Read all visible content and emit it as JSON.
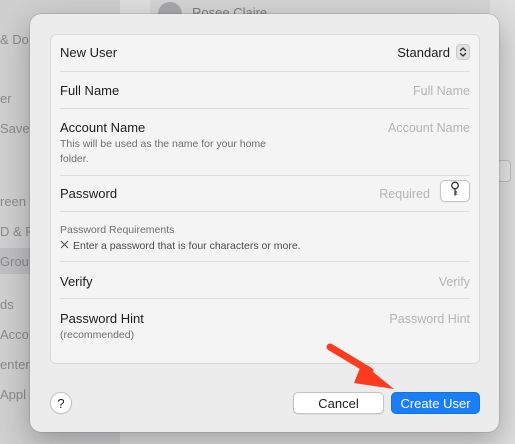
{
  "background": {
    "sidebar_fragments": [
      "& Do",
      "er",
      "Saver",
      "reen",
      "D & Pa",
      "Grou",
      "ds",
      "Acco",
      "enter",
      "Appl"
    ],
    "user_row_name": "Rosee Claire"
  },
  "sheet": {
    "fields": {
      "new_user": {
        "label": "New User",
        "value": "Standard"
      },
      "full_name": {
        "label": "Full Name",
        "placeholder": "Full Name"
      },
      "account_name": {
        "label": "Account Name",
        "sublabel": "This will be used as the name for your home folder.",
        "placeholder": "Account Name"
      },
      "password": {
        "label": "Password",
        "placeholder": "Required"
      },
      "password_requirements": {
        "title": "Password Requirements",
        "item": "Enter a password that is four characters or more."
      },
      "verify": {
        "label": "Verify",
        "placeholder": "Verify"
      },
      "password_hint": {
        "label": "Password Hint",
        "sublabel": "(recommended)",
        "placeholder": "Password Hint"
      }
    },
    "footer": {
      "help_label": "?",
      "cancel_label": "Cancel",
      "create_label": "Create User"
    }
  },
  "icons": {
    "select_stepper": "chevron-up-down-icon",
    "key": "key-icon",
    "requirement_status": "x-mark-icon",
    "annotation": "red-arrow-icon"
  },
  "colors": {
    "accent": "#1a7ef6",
    "annotation_arrow": "#ff3b1f"
  }
}
